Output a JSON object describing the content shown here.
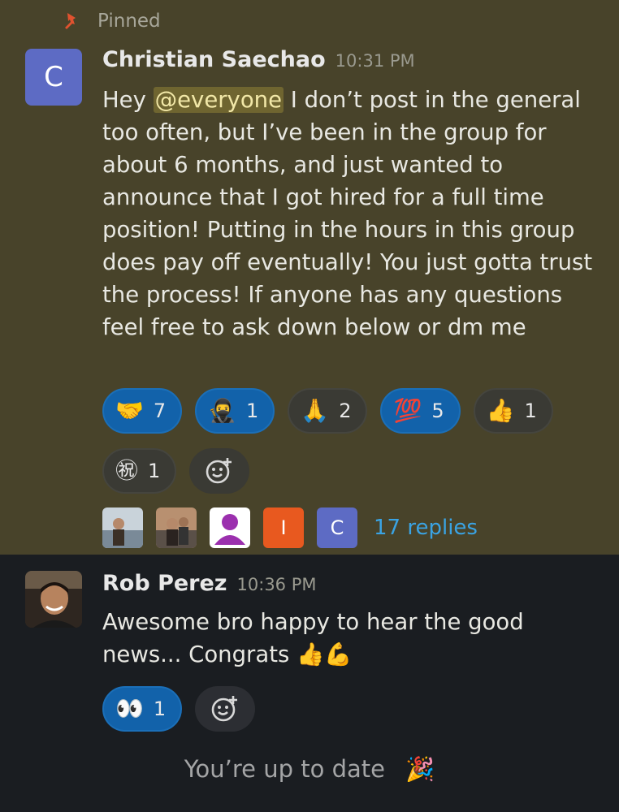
{
  "pinned": {
    "label": "Pinned"
  },
  "message1": {
    "avatar_letter": "C",
    "author": "Christian Saechao",
    "time": "10:31 PM",
    "text_before": "Hey ",
    "mention": "@everyone",
    "text_after": " I don’t post in the general too often, but I’ve been in the group for about 6 months, and just wanted to announce that I got hired for a full time position! Putting in the hours in this group does pay off eventually! You just gotta trust the process! If anyone has any questions feel free to ask down below or dm me",
    "reactions": [
      {
        "emoji": "🤝",
        "count": "7",
        "icon": "handshake-icon",
        "active": true
      },
      {
        "emoji": "🥷",
        "count": "1",
        "icon": "ninja-icon",
        "active": true
      },
      {
        "emoji": "🙏",
        "count": "2",
        "icon": "folded-hands-icon",
        "active": false
      },
      {
        "emoji": "💯",
        "count": "5",
        "icon": "hundred-points-icon",
        "active": true
      },
      {
        "emoji": "👍",
        "count": "1",
        "icon": "thumbs-up-icon",
        "active": false
      },
      {
        "emoji": "㊗",
        "count": "1",
        "icon": "congratulations-icon",
        "active": false
      }
    ],
    "reply_avatars": [
      {
        "type": "photo",
        "name": "reply-avatar-1"
      },
      {
        "type": "photo",
        "name": "reply-avatar-2"
      },
      {
        "type": "generic",
        "name": "reply-avatar-3"
      },
      {
        "type": "letter",
        "letter": "I",
        "color": "#e8591f",
        "name": "reply-avatar-4"
      },
      {
        "type": "letter",
        "letter": "C",
        "color": "#5d6bc4",
        "name": "reply-avatar-5"
      }
    ],
    "replies": "17 replies"
  },
  "message2": {
    "author": "Rob Perez",
    "time": "10:36 PM",
    "text": "Awesome bro happy to hear the good news... Congrats",
    "text_emoji": "👍💪",
    "reactions": [
      {
        "emoji": "👀",
        "count": "1",
        "icon": "eyes-icon",
        "active": true
      }
    ]
  },
  "status": {
    "up_to_date": "You’re up to date",
    "emoji": "🎉"
  },
  "colors": {
    "pinned_bg": "#48432a",
    "base_bg": "#1a1d21",
    "link": "#3aa3e3",
    "active_reaction": "#1262aa"
  }
}
